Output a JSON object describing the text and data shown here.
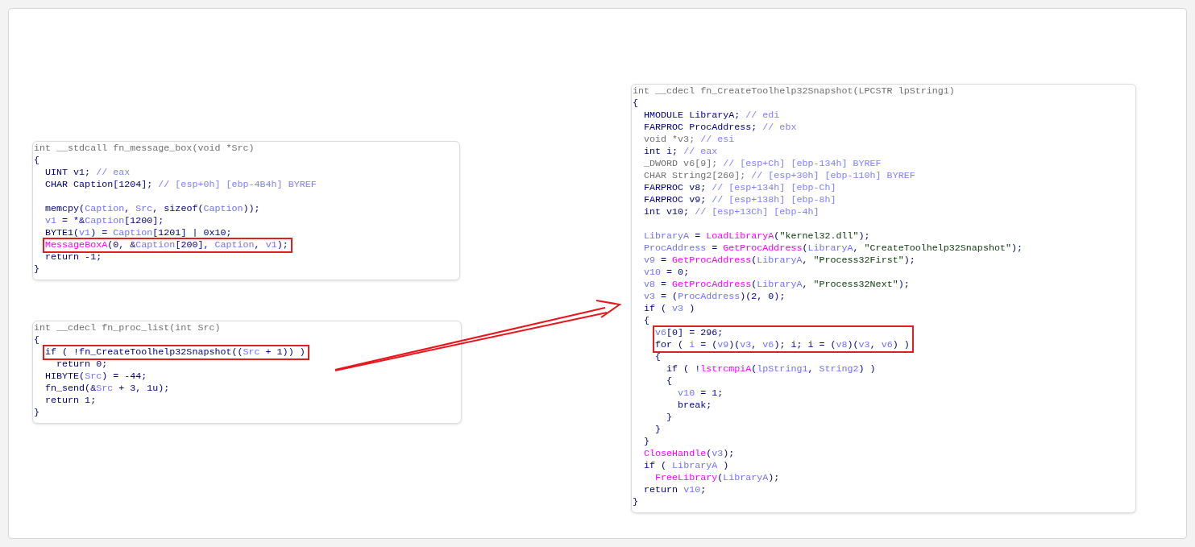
{
  "panels": [
    {
      "lines": [
        {
          "segments": [
            {
              "kind": "sig",
              "text": "int __stdcall fn_message_box(void *Src)"
            }
          ]
        },
        {
          "segments": [
            {
              "kind": "plain",
              "text": "{"
            }
          ]
        },
        {
          "segments": [
            {
              "kind": "plain",
              "text": "  UINT v1; "
            },
            {
              "kind": "cmt",
              "text": "// eax"
            }
          ]
        },
        {
          "segments": [
            {
              "kind": "plain",
              "text": "  CHAR Caption[1204]; "
            },
            {
              "kind": "cmt",
              "text": "// [esp+0h] [ebp-4B4h] BYREF"
            }
          ]
        },
        {
          "gap_before": true,
          "segments": [
            {
              "kind": "plain",
              "text": "  memcpy("
            },
            {
              "kind": "var",
              "text": "Caption"
            },
            {
              "kind": "plain",
              "text": ", "
            },
            {
              "kind": "var",
              "text": "Src"
            },
            {
              "kind": "plain",
              "text": ", sizeof("
            },
            {
              "kind": "var",
              "text": "Caption"
            },
            {
              "kind": "plain",
              "text": "));"
            }
          ]
        },
        {
          "segments": [
            {
              "kind": "var",
              "text": "  v1"
            },
            {
              "kind": "plain",
              "text": " = *&"
            },
            {
              "kind": "var",
              "text": "Caption"
            },
            {
              "kind": "plain",
              "text": "[1200];"
            }
          ]
        },
        {
          "segments": [
            {
              "kind": "plain",
              "text": "  BYTE1("
            },
            {
              "kind": "var",
              "text": "v1"
            },
            {
              "kind": "plain",
              "text": ") = "
            },
            {
              "kind": "var",
              "text": "Caption"
            },
            {
              "kind": "plain",
              "text": "[1201] | 0x10;"
            }
          ]
        },
        {
          "boxed": true,
          "segments": [
            {
              "kind": "fn",
              "text": "  MessageBoxA"
            },
            {
              "kind": "plain",
              "text": "(0, &"
            },
            {
              "kind": "var",
              "text": "Caption"
            },
            {
              "kind": "plain",
              "text": "[200], "
            },
            {
              "kind": "var",
              "text": "Caption"
            },
            {
              "kind": "plain",
              "text": ", "
            },
            {
              "kind": "var",
              "text": "v1"
            },
            {
              "kind": "plain",
              "text": ");"
            }
          ]
        },
        {
          "segments": [
            {
              "kind": "plain",
              "text": "  return -1;"
            }
          ]
        },
        {
          "segments": [
            {
              "kind": "plain",
              "text": "}"
            }
          ]
        }
      ]
    },
    {
      "lines": [
        {
          "segments": [
            {
              "kind": "sig",
              "text": "int __cdecl fn_proc_list(int Src)"
            }
          ]
        },
        {
          "segments": [
            {
              "kind": "plain",
              "text": "{"
            }
          ]
        },
        {
          "boxed": true,
          "segments": [
            {
              "kind": "plain",
              "text": "  if ( !fn_CreateToolhelp32Snapshot(("
            },
            {
              "kind": "var",
              "text": "Src"
            },
            {
              "kind": "plain",
              "text": " + 1)) )"
            }
          ]
        },
        {
          "segments": [
            {
              "kind": "plain",
              "text": "    return 0;"
            }
          ]
        },
        {
          "segments": [
            {
              "kind": "plain",
              "text": "  HIBYTE("
            },
            {
              "kind": "var",
              "text": "Src"
            },
            {
              "kind": "plain",
              "text": ") = -44;"
            }
          ]
        },
        {
          "segments": [
            {
              "kind": "plain",
              "text": "  fn_send(&"
            },
            {
              "kind": "var",
              "text": "Src"
            },
            {
              "kind": "plain",
              "text": " + 3, 1u);"
            }
          ]
        },
        {
          "segments": [
            {
              "kind": "plain",
              "text": "  return 1;"
            }
          ]
        },
        {
          "segments": [
            {
              "kind": "plain",
              "text": "}"
            }
          ]
        }
      ]
    },
    {
      "lines": [
        {
          "segments": [
            {
              "kind": "sig",
              "text": "int __cdecl fn_CreateToolhelp32Snapshot(LPCSTR lpString1)"
            }
          ]
        },
        {
          "segments": [
            {
              "kind": "plain",
              "text": "{"
            }
          ]
        },
        {
          "segments": [
            {
              "kind": "plain",
              "text": "  HMODULE LibraryA; "
            },
            {
              "kind": "cmt",
              "text": "// edi"
            }
          ]
        },
        {
          "segments": [
            {
              "kind": "plain",
              "text": "  FARPROC ProcAddress; "
            },
            {
              "kind": "cmt",
              "text": "// ebx"
            }
          ]
        },
        {
          "segments": [
            {
              "kind": "sig",
              "text": "  void *v3; "
            },
            {
              "kind": "cmt",
              "text": "// esi"
            }
          ]
        },
        {
          "segments": [
            {
              "kind": "plain",
              "text": "  int i; "
            },
            {
              "kind": "cmt",
              "text": "// eax"
            }
          ]
        },
        {
          "segments": [
            {
              "kind": "sig",
              "text": "  _DWORD v6[9]; "
            },
            {
              "kind": "cmt",
              "text": "// [esp+Ch] [ebp-134h] BYREF"
            }
          ]
        },
        {
          "segments": [
            {
              "kind": "sig",
              "text": "  CHAR String2[260]; "
            },
            {
              "kind": "cmt",
              "text": "// [esp+30h] [ebp-110h] BYREF"
            }
          ]
        },
        {
          "segments": [
            {
              "kind": "plain",
              "text": "  FARPROC v8; "
            },
            {
              "kind": "cmt",
              "text": "// [esp+134h] [ebp-Ch]"
            }
          ]
        },
        {
          "segments": [
            {
              "kind": "plain",
              "text": "  FARPROC v9; "
            },
            {
              "kind": "cmt",
              "text": "// [esp+138h] [ebp-8h]"
            }
          ]
        },
        {
          "segments": [
            {
              "kind": "plain",
              "text": "  int v10; "
            },
            {
              "kind": "cmt",
              "text": "// [esp+13Ch] [ebp-4h]"
            }
          ]
        },
        {
          "gap_before": true,
          "segments": [
            {
              "kind": "var",
              "text": "  LibraryA"
            },
            {
              "kind": "plain",
              "text": " = "
            },
            {
              "kind": "fn",
              "text": "LoadLibraryA"
            },
            {
              "kind": "plain",
              "text": "("
            },
            {
              "kind": "str",
              "text": "\"kernel32.dll\""
            },
            {
              "kind": "plain",
              "text": ");"
            }
          ]
        },
        {
          "segments": [
            {
              "kind": "var",
              "text": "  ProcAddress"
            },
            {
              "kind": "plain",
              "text": " = "
            },
            {
              "kind": "fn",
              "text": "GetProcAddress"
            },
            {
              "kind": "plain",
              "text": "("
            },
            {
              "kind": "var",
              "text": "LibraryA"
            },
            {
              "kind": "plain",
              "text": ", "
            },
            {
              "kind": "str",
              "text": "\"CreateToolhelp32Snapshot\""
            },
            {
              "kind": "plain",
              "text": ");"
            }
          ]
        },
        {
          "segments": [
            {
              "kind": "var",
              "text": "  v9"
            },
            {
              "kind": "plain",
              "text": " = "
            },
            {
              "kind": "fn",
              "text": "GetProcAddress"
            },
            {
              "kind": "plain",
              "text": "("
            },
            {
              "kind": "var",
              "text": "LibraryA"
            },
            {
              "kind": "plain",
              "text": ", "
            },
            {
              "kind": "str",
              "text": "\"Process32First\""
            },
            {
              "kind": "plain",
              "text": ");"
            }
          ]
        },
        {
          "segments": [
            {
              "kind": "var",
              "text": "  v10"
            },
            {
              "kind": "plain",
              "text": " = 0;"
            }
          ]
        },
        {
          "segments": [
            {
              "kind": "var",
              "text": "  v8"
            },
            {
              "kind": "plain",
              "text": " = "
            },
            {
              "kind": "fn",
              "text": "GetProcAddress"
            },
            {
              "kind": "plain",
              "text": "("
            },
            {
              "kind": "var",
              "text": "LibraryA"
            },
            {
              "kind": "plain",
              "text": ", "
            },
            {
              "kind": "str",
              "text": "\"Process32Next\""
            },
            {
              "kind": "plain",
              "text": ");"
            }
          ]
        },
        {
          "segments": [
            {
              "kind": "var",
              "text": "  v3"
            },
            {
              "kind": "plain",
              "text": " = ("
            },
            {
              "kind": "var",
              "text": "ProcAddress"
            },
            {
              "kind": "plain",
              "text": ")(2, 0);"
            }
          ]
        },
        {
          "segments": [
            {
              "kind": "plain",
              "text": "  if ( "
            },
            {
              "kind": "var",
              "text": "v3"
            },
            {
              "kind": "plain",
              "text": " )"
            }
          ]
        },
        {
          "segments": [
            {
              "kind": "plain",
              "text": "  {"
            }
          ]
        },
        {
          "boxed": true,
          "segments": [
            {
              "kind": "var",
              "text": "    v6"
            },
            {
              "kind": "plain",
              "text": "[0] = 296;"
            }
          ]
        },
        {
          "boxed": true,
          "segments": [
            {
              "kind": "plain",
              "text": "    for ( "
            },
            {
              "kind": "var",
              "text": "i"
            },
            {
              "kind": "plain",
              "text": " = ("
            },
            {
              "kind": "var",
              "text": "v9"
            },
            {
              "kind": "plain",
              "text": ")("
            },
            {
              "kind": "var",
              "text": "v3"
            },
            {
              "kind": "plain",
              "text": ", "
            },
            {
              "kind": "var",
              "text": "v6"
            },
            {
              "kind": "plain",
              "text": "); i; i = ("
            },
            {
              "kind": "var",
              "text": "v8"
            },
            {
              "kind": "plain",
              "text": ")("
            },
            {
              "kind": "var",
              "text": "v3"
            },
            {
              "kind": "plain",
              "text": ", "
            },
            {
              "kind": "var",
              "text": "v6"
            },
            {
              "kind": "plain",
              "text": ") )"
            }
          ]
        },
        {
          "segments": [
            {
              "kind": "plain",
              "text": "    {"
            }
          ]
        },
        {
          "segments": [
            {
              "kind": "plain",
              "text": "      if ( !"
            },
            {
              "kind": "fn",
              "text": "lstrcmpiA"
            },
            {
              "kind": "plain",
              "text": "("
            },
            {
              "kind": "var",
              "text": "lpString1"
            },
            {
              "kind": "plain",
              "text": ", "
            },
            {
              "kind": "var",
              "text": "String2"
            },
            {
              "kind": "plain",
              "text": ") )"
            }
          ]
        },
        {
          "segments": [
            {
              "kind": "plain",
              "text": "      {"
            }
          ]
        },
        {
          "segments": [
            {
              "kind": "var",
              "text": "        v10"
            },
            {
              "kind": "plain",
              "text": " = 1;"
            }
          ]
        },
        {
          "segments": [
            {
              "kind": "plain",
              "text": "        break;"
            }
          ]
        },
        {
          "segments": [
            {
              "kind": "plain",
              "text": "      }"
            }
          ]
        },
        {
          "segments": [
            {
              "kind": "plain",
              "text": "    }"
            }
          ]
        },
        {
          "segments": [
            {
              "kind": "plain",
              "text": "  }"
            }
          ]
        },
        {
          "segments": [
            {
              "kind": "fn",
              "text": "  CloseHandle"
            },
            {
              "kind": "plain",
              "text": "("
            },
            {
              "kind": "var",
              "text": "v3"
            },
            {
              "kind": "plain",
              "text": ");"
            }
          ]
        },
        {
          "segments": [
            {
              "kind": "plain",
              "text": "  if ( "
            },
            {
              "kind": "var",
              "text": "LibraryA"
            },
            {
              "kind": "plain",
              "text": " )"
            }
          ]
        },
        {
          "segments": [
            {
              "kind": "fn",
              "text": "    FreeLibrary"
            },
            {
              "kind": "plain",
              "text": "("
            },
            {
              "kind": "var",
              "text": "LibraryA"
            },
            {
              "kind": "plain",
              "text": ");"
            }
          ]
        },
        {
          "segments": [
            {
              "kind": "plain",
              "text": "  return "
            },
            {
              "kind": "var",
              "text": "v10"
            },
            {
              "kind": "plain",
              "text": ";"
            }
          ]
        },
        {
          "segments": [
            {
              "kind": "plain",
              "text": "}"
            }
          ]
        }
      ]
    }
  ]
}
